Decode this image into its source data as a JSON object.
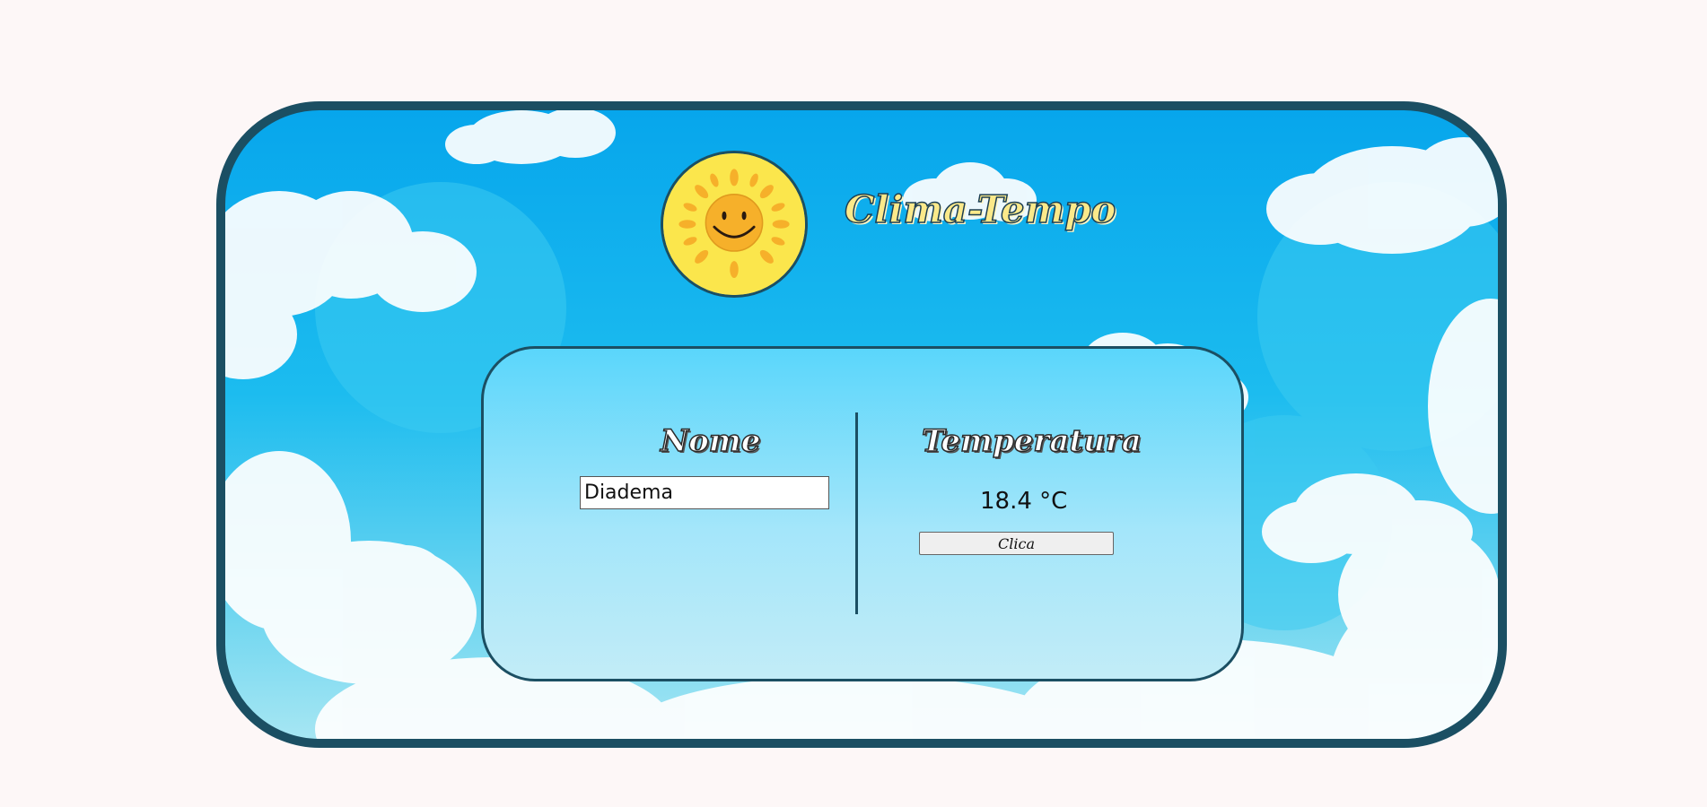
{
  "app": {
    "title": "Clima-Tempo"
  },
  "panel": {
    "name_label": "Nome",
    "name_input_value": "Diadema",
    "temperature_label": "Temperatura",
    "temperature_value": "18.4 °C",
    "button_label": "Clica"
  },
  "icons": {
    "logo": "smiling-sun-icon"
  },
  "colors": {
    "page_background": "#fdf7f7",
    "frame_border": "#1b4f63",
    "sky_top": "#07a6ec",
    "panel_top": "#5ad6fb",
    "panel_bottom": "#c2ecf7",
    "sun_yellow": "#fdf045",
    "title_fill": "#fbe98a"
  }
}
